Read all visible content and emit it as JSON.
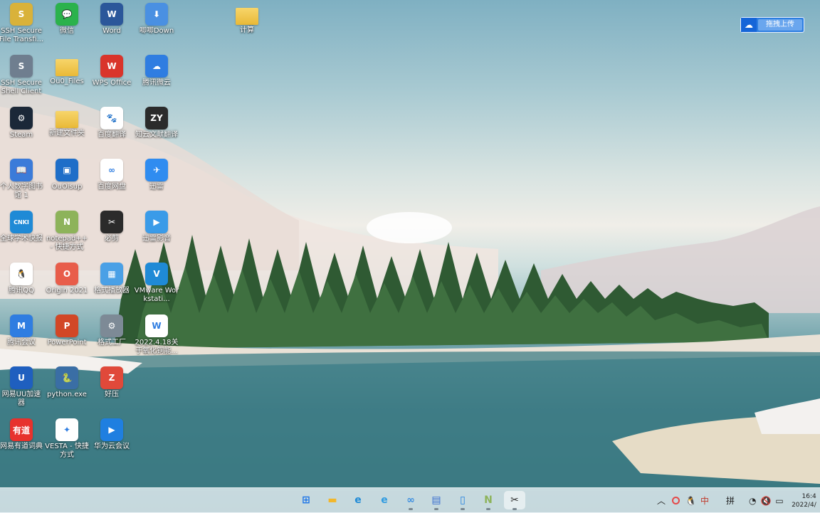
{
  "desktop": {
    "icons": [
      {
        "label": "SSH Secure File Transfi...",
        "color": "#d9b23a",
        "glyph": "S"
      },
      {
        "label": "微信",
        "color": "#2bb24c",
        "glyph": "💬"
      },
      {
        "label": "Word",
        "color": "#2b579a",
        "glyph": "W"
      },
      {
        "label": "唧唧Down",
        "color": "#4a90e2",
        "glyph": "⬇"
      },
      {
        "label": "计算",
        "color": "#f2c14e",
        "glyph": ""
      },
      {
        "label": "SSH Secure Shell Client",
        "color": "#6f7e8f",
        "glyph": "S"
      },
      {
        "label": "Ou0_Files",
        "color": "#f2c14e",
        "glyph": ""
      },
      {
        "label": "WPS Office",
        "color": "#d9342b",
        "glyph": "W"
      },
      {
        "label": "腾讯微云",
        "color": "#2f7de1",
        "glyph": "☁"
      },
      {
        "label": "Steam",
        "color": "#1b2838",
        "glyph": "⚙"
      },
      {
        "label": "新建文件夹",
        "color": "#f2c14e",
        "glyph": ""
      },
      {
        "label": "百度翻译",
        "color": "#ffffff",
        "glyph": "🐾"
      },
      {
        "label": "知云文献翻译",
        "color": "#2b2b2b",
        "glyph": "ZY"
      },
      {
        "label": "个人数字图书馆 1",
        "color": "#3b7bd9",
        "glyph": "📖"
      },
      {
        "label": "OuOisup",
        "color": "#1e6ec8",
        "glyph": "▣"
      },
      {
        "label": "百度网盘",
        "color": "#ffffff",
        "glyph": "∞"
      },
      {
        "label": "迅雷",
        "color": "#2f8cf0",
        "glyph": "✈"
      },
      {
        "label": "全球学术快报",
        "color": "#1f8ad6",
        "glyph": "CNKI"
      },
      {
        "label": "notepad++ - 快捷方式",
        "color": "#8db35a",
        "glyph": "N"
      },
      {
        "label": "必剪",
        "color": "#2b2b2b",
        "glyph": "✂"
      },
      {
        "label": "迅雷影音",
        "color": "#3a9be8",
        "glyph": "▶"
      },
      {
        "label": "腾讯QQ",
        "color": "#ffffff",
        "glyph": "🐧"
      },
      {
        "label": "Origin 2021",
        "color": "#e85d4a",
        "glyph": "O"
      },
      {
        "label": "格式播放器",
        "color": "#4aa0e6",
        "glyph": "▦"
      },
      {
        "label": "VMware Workstati...",
        "color": "#1f8ad6",
        "glyph": "V"
      },
      {
        "label": "腾讯会议",
        "color": "#2f7de1",
        "glyph": "M"
      },
      {
        "label": "PowerPoint",
        "color": "#d24726",
        "glyph": "P"
      },
      {
        "label": "格式工厂",
        "color": "#7d8a96",
        "glyph": "⚙"
      },
      {
        "label": "2022.4.18关于氧化铜能...",
        "color": "#ffffff",
        "glyph": "W"
      },
      {
        "label": "网易UU加速器",
        "color": "#1f5fbf",
        "glyph": "U"
      },
      {
        "label": "python.exe",
        "color": "#3a6ea5",
        "glyph": "🐍"
      },
      {
        "label": "好压",
        "color": "#e0493a",
        "glyph": "Z"
      },
      {
        "label": "网易有道词典",
        "color": "#e7322d",
        "glyph": "有道"
      },
      {
        "label": "VESTA - 快捷方式",
        "color": "#ffffff",
        "glyph": "✦"
      },
      {
        "label": "华为云会议",
        "color": "#1f7fe0",
        "glyph": "▶"
      }
    ]
  },
  "upload_widget": {
    "label": "拖拽上传",
    "icon": "cloud-icon"
  },
  "taskbar": {
    "apps": [
      {
        "name": "start",
        "glyph": "⊞",
        "color": "#1a73e8"
      },
      {
        "name": "file-explorer",
        "glyph": "▬",
        "color": "#f2b72b"
      },
      {
        "name": "edge",
        "glyph": "e",
        "color": "#1f8ad6"
      },
      {
        "name": "internet-explorer",
        "glyph": "e",
        "color": "#2f9be0"
      },
      {
        "name": "baidu-netdisk",
        "glyph": "∞",
        "color": "#3a8de0"
      },
      {
        "name": "document-app",
        "glyph": "▤",
        "color": "#3a6fd0"
      },
      {
        "name": "phone-link",
        "glyph": "▯",
        "color": "#1f7fe0"
      },
      {
        "name": "notepad-plus",
        "glyph": "N",
        "color": "#8db35a"
      },
      {
        "name": "bijian",
        "glyph": "✂",
        "color": "#2b2b2b"
      }
    ],
    "tray": {
      "ime_lang": "中",
      "ime_mode": "拼",
      "time": "16:4",
      "date": "2022/4/"
    }
  }
}
